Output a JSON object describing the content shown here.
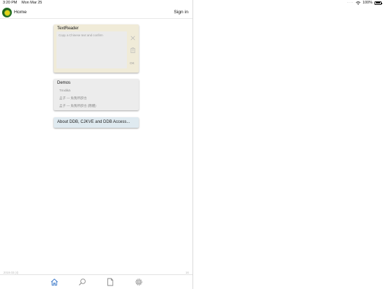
{
  "statusbar": {
    "time": "3:20 PM",
    "date": "Mon Mar 25",
    "battery": "100%"
  },
  "navbar": {
    "title": "Home",
    "sign_in": "Sign in"
  },
  "text_reader": {
    "title": "TextReader",
    "placeholder": "Copy a Chinese text and confirm",
    "ok_label": "OK"
  },
  "demos": {
    "title": "Demos",
    "items": [
      "Tmxlikä",
      "孟子 — 魚我所欲也",
      "孟子 — 魚我所欲也 (簡體)"
    ]
  },
  "about": {
    "label": "About DDB, CJKVE and DDB Access..."
  },
  "footer": {
    "version": "2019.03 (4)",
    "number": "16"
  },
  "tabs": [
    "home-icon",
    "search-icon",
    "document-icon",
    "settings-icon"
  ],
  "colors": {
    "accent": "#3a78c9",
    "reader_bg": "#f0ebd8",
    "about_bg": "#dfeaf0"
  }
}
